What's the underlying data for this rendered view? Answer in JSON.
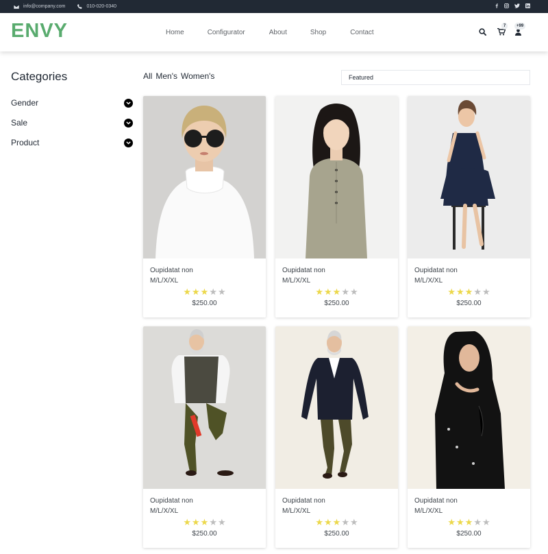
{
  "topbar": {
    "email": "info@company.com",
    "phone": "010-020-0340",
    "social_icons": [
      "facebook-icon",
      "instagram-icon",
      "twitter-icon",
      "linkedin-icon"
    ]
  },
  "header": {
    "logo": "ENVY",
    "logo_color": "#59ab6e",
    "nav": [
      "Home",
      "Configurator",
      "About",
      "Shop",
      "Contact"
    ],
    "cart_count": "7",
    "user_count": "+99"
  },
  "sidebar": {
    "title": "Categories",
    "items": [
      "Gender",
      "Sale",
      "Product"
    ]
  },
  "filters": {
    "tabs": [
      "All",
      "Men's",
      "Women's"
    ],
    "sort_selected": "Featured"
  },
  "products": [
    {
      "name": "Oupidatat non",
      "sizes": "M/L/X/XL",
      "rating": 3,
      "price": "$250.00",
      "image": "woman-white-turtleneck-sunglasses"
    },
    {
      "name": "Oupidatat non",
      "sizes": "M/L/X/XL",
      "rating": 3,
      "price": "$250.00",
      "image": "woman-green-dress"
    },
    {
      "name": "Oupidatat non",
      "sizes": "M/L/X/XL",
      "rating": 3,
      "price": "$250.00",
      "image": "woman-navy-dress-on-stool"
    },
    {
      "name": "Oupidatat non",
      "sizes": "M/L/X/XL",
      "rating": 3,
      "price": "$250.00",
      "image": "older-man-vest-yoga-pose"
    },
    {
      "name": "Oupidatat non",
      "sizes": "M/L/X/XL",
      "rating": 3,
      "price": "$250.00",
      "image": "older-man-blazer-walking"
    },
    {
      "name": "Oupidatat non",
      "sizes": "M/L/X/XL",
      "rating": 3,
      "price": "$250.00",
      "image": "woman-black-hijab-abaya"
    }
  ],
  "colors": {
    "topbar_bg": "#212934",
    "star_on": "#ecd84b",
    "star_off": "#bdbdbd"
  }
}
